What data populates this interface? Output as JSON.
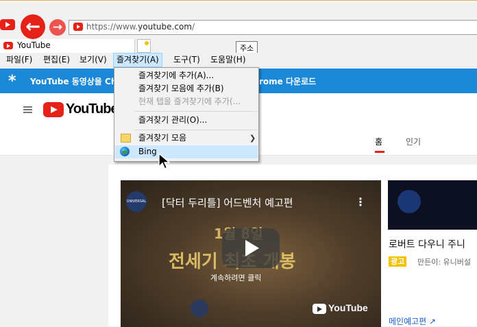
{
  "address_bar": {
    "url_prefix": "https://www.",
    "url_domain": "youtube.com",
    "url_suffix": "/"
  },
  "tab": {
    "title": "YouTube"
  },
  "tooltip": {
    "text": "주소"
  },
  "menubar": {
    "items": [
      "파일(F)",
      "편집(E)",
      "보기(V)",
      "즐겨찾기(A)",
      "도구(T)",
      "도움말(H)"
    ]
  },
  "favorites_menu": {
    "add_to_favorites": "즐겨찾기에 추가(A)...",
    "add_to_favorites_bar": "즐겨찾기 모음에 추가(B)",
    "add_current_tabs": "현재 탭을 즐겨찾기에 추가(...",
    "organize": "즐겨찾기 관리(O)...",
    "favorites_bar": "즐겨찾기 모음",
    "bing": "Bing",
    "highlighted": "Bing"
  },
  "banner": {
    "text_left": "YouTube 동영상을 Ch",
    "text_right": "rome 다운로드",
    "color": "#1b88d8"
  },
  "youtube": {
    "logo_text": "YouTube",
    "nav_home": "홈",
    "nav_popular": "인기"
  },
  "video": {
    "title": "[닥터 두리틀] 어드벤처 예고편",
    "overlay_line1": "1월 8일",
    "overlay_line2": "전세기 최초 개봉",
    "click_hint": "계속하려면 클릭",
    "yt_watermark": "YouTube",
    "studio_badge": "UNIVERSAL"
  },
  "side": {
    "title": "로버트 다우니 주니",
    "ad_badge": "광고",
    "maker": "만든이: 유니버설",
    "link": "메인예고편"
  },
  "icons": {
    "back": "arrow-left-icon",
    "forward": "arrow-right-icon",
    "bing": "globe-icon",
    "folder": "folder-icon"
  },
  "colors": {
    "youtube_red": "#e62117",
    "menu_highlight": "#cce8ff",
    "ad_yellow": "#f2c200"
  }
}
